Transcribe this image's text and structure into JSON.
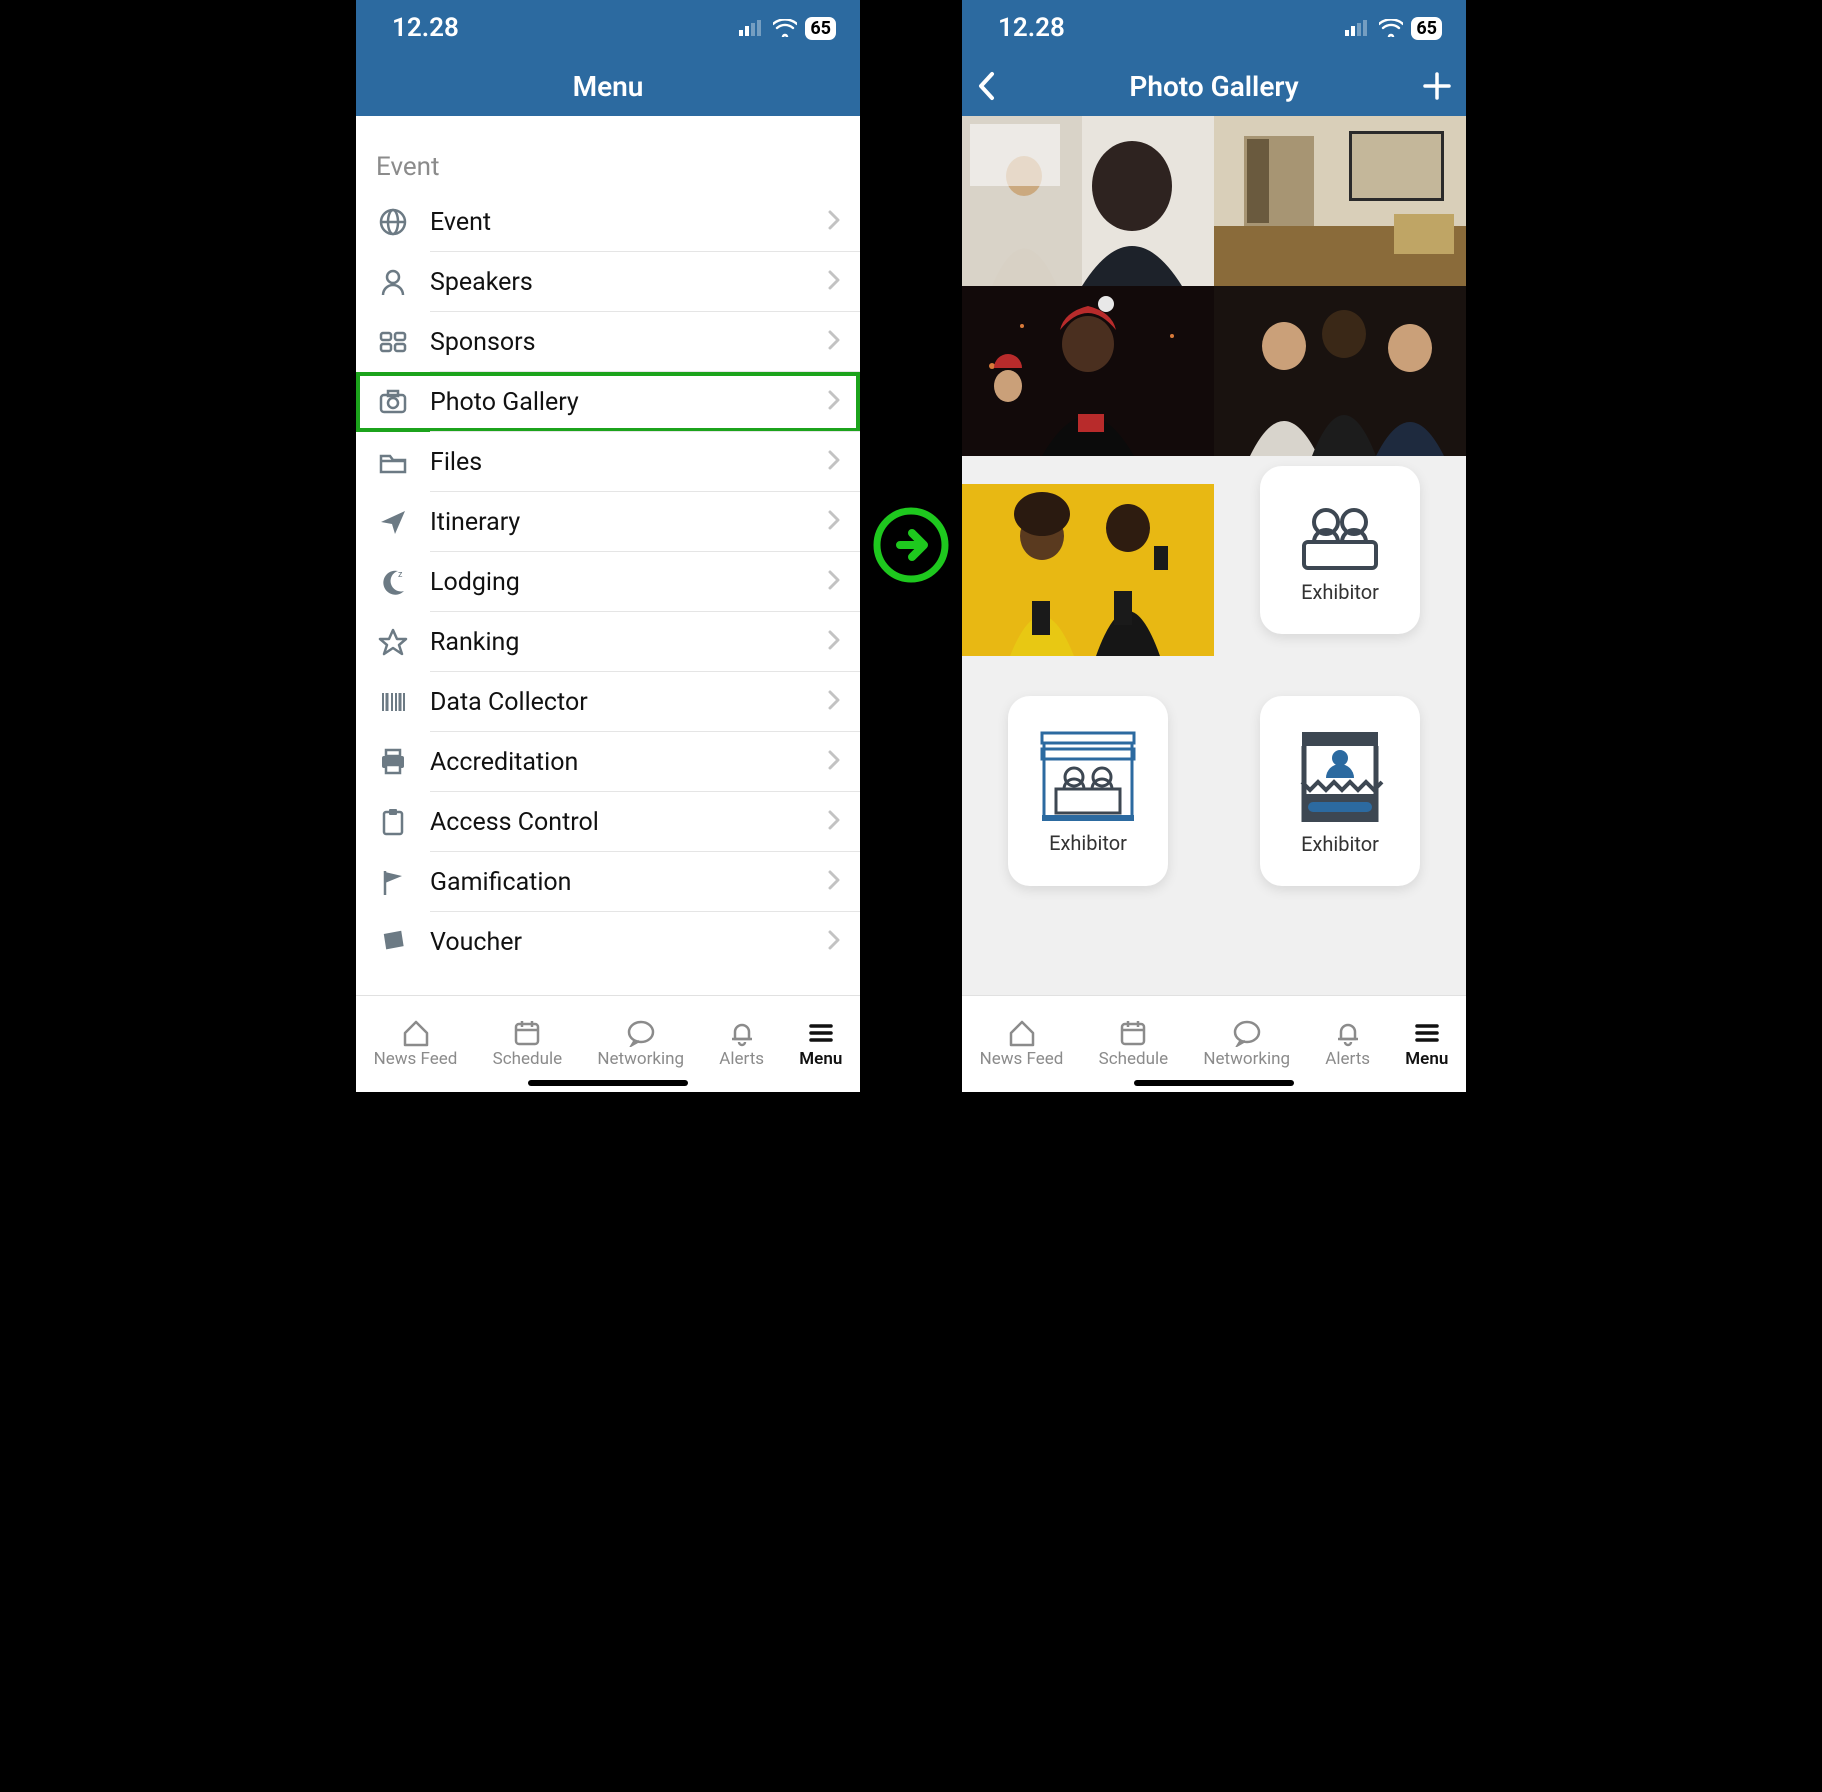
{
  "status": {
    "time": "12.28",
    "battery": "65"
  },
  "left": {
    "title": "Menu",
    "section": "Event",
    "items": [
      {
        "icon": "globe",
        "label": "Event"
      },
      {
        "icon": "person",
        "label": "Speakers"
      },
      {
        "icon": "grid",
        "label": "Sponsors"
      },
      {
        "icon": "camera",
        "label": "Photo Gallery",
        "highlight": true
      },
      {
        "icon": "folder",
        "label": "Files"
      },
      {
        "icon": "send",
        "label": "Itinerary"
      },
      {
        "icon": "moon",
        "label": "Lodging"
      },
      {
        "icon": "star",
        "label": "Ranking"
      },
      {
        "icon": "barcode",
        "label": "Data Collector"
      },
      {
        "icon": "printer",
        "label": "Accreditation"
      },
      {
        "icon": "clipboard",
        "label": "Access Control"
      },
      {
        "icon": "flag",
        "label": "Gamification"
      },
      {
        "icon": "ticket",
        "label": "Voucher"
      }
    ]
  },
  "right": {
    "title": "Photo Gallery",
    "exhibitor_label": "Exhibitor"
  },
  "tabs": [
    {
      "icon": "home",
      "label": "News Feed"
    },
    {
      "icon": "calendar",
      "label": "Schedule"
    },
    {
      "icon": "chat",
      "label": "Networking"
    },
    {
      "icon": "bell",
      "label": "Alerts"
    },
    {
      "icon": "menu",
      "label": "Menu",
      "active": true
    }
  ]
}
